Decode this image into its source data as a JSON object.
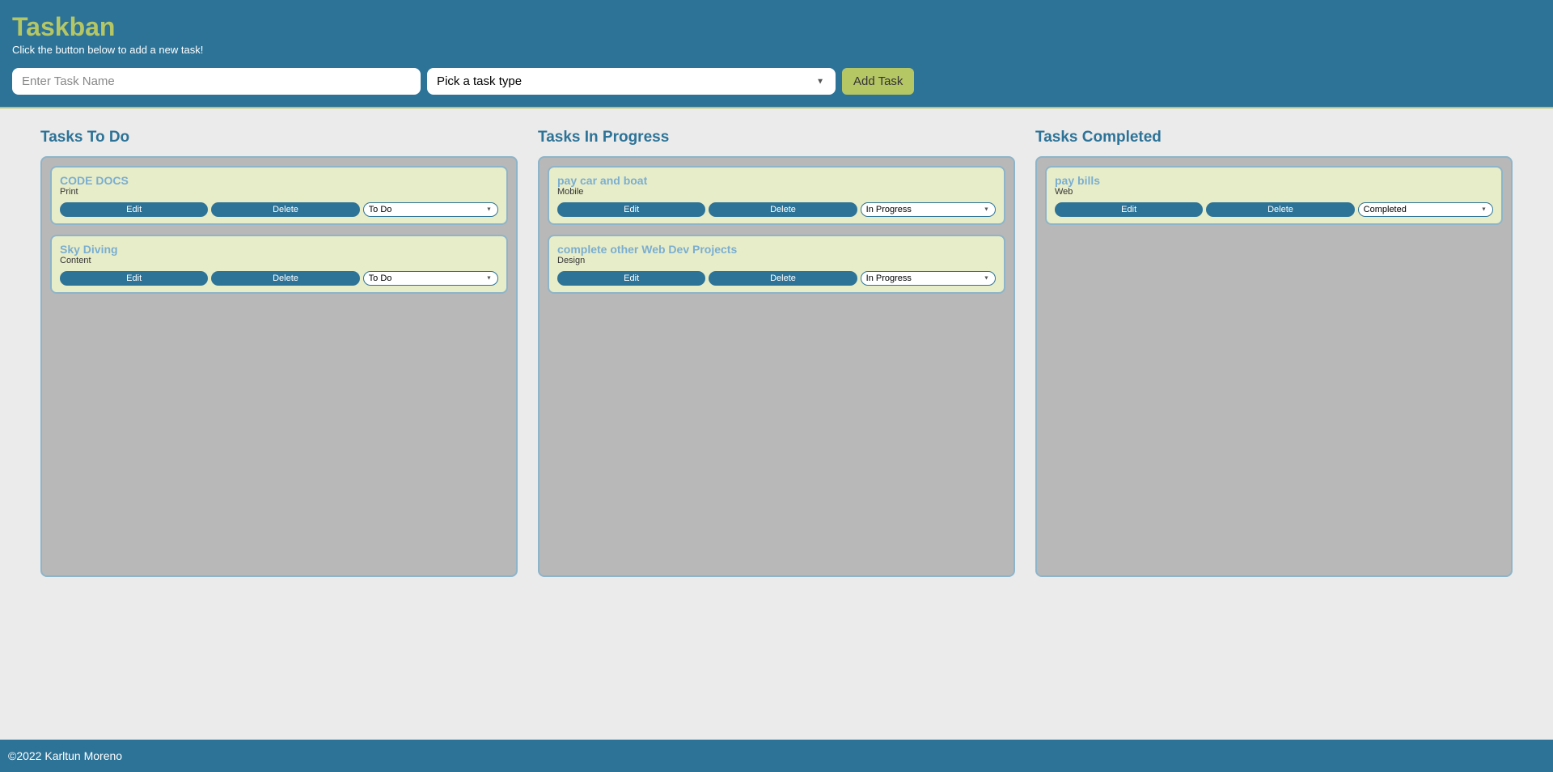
{
  "header": {
    "title": "Taskban",
    "subtitle": "Click the button below to add a new task!",
    "task_input_placeholder": "Enter Task Name",
    "type_select_placeholder": "Pick a task type",
    "add_button_label": "Add Task"
  },
  "columns": [
    {
      "title": "Tasks To Do",
      "status_value": "To Do",
      "tasks": [
        {
          "title": "CODE DOCS",
          "type": "Print"
        },
        {
          "title": "Sky Diving",
          "type": "Content"
        }
      ]
    },
    {
      "title": "Tasks In Progress",
      "status_value": "In Progress",
      "tasks": [
        {
          "title": "pay car and boat",
          "type": "Mobile"
        },
        {
          "title": "complete other Web Dev Projects",
          "type": "Design"
        }
      ]
    },
    {
      "title": "Tasks Completed",
      "status_value": "Completed",
      "tasks": [
        {
          "title": "pay bills",
          "type": "Web"
        }
      ]
    }
  ],
  "card_buttons": {
    "edit": "Edit",
    "delete": "Delete"
  },
  "status_options": [
    "To Do",
    "In Progress",
    "Completed"
  ],
  "footer": {
    "copyright": "©2022 Karltun Moreno"
  }
}
